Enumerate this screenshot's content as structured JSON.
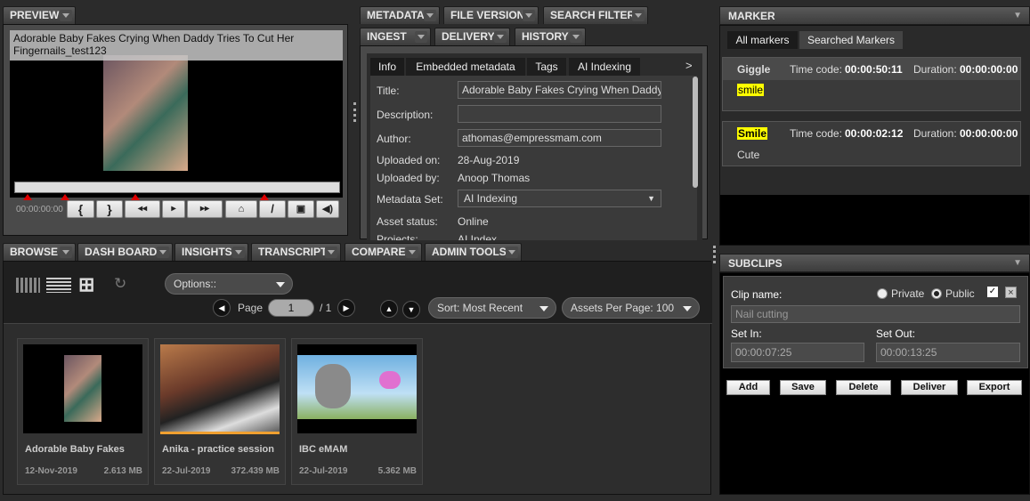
{
  "preview": {
    "tab": "PREVIEW",
    "title": "Adorable Baby Fakes Crying When Daddy Tries To Cut Her Fingernails_test123",
    "timecode": "00:00:00:00"
  },
  "meta_tabs": {
    "row1": [
      "METADATA",
      "FILE VERSION",
      "SEARCH FILTER"
    ],
    "row2": [
      "INGEST",
      "DELIVERY",
      "HISTORY"
    ],
    "sub": [
      "Info",
      "Embedded metadata",
      "Tags",
      "AI Indexing"
    ],
    "more": ">"
  },
  "info": {
    "title_label": "Title:",
    "title_value": "Adorable Baby Fakes Crying When Daddy",
    "description_label": "Description:",
    "description_value": "",
    "author_label": "Author:",
    "author_value": "athomas@empressmam.com",
    "uploaded_on_label": "Uploaded on:",
    "uploaded_on_value": "28-Aug-2019",
    "uploaded_by_label": "Uploaded by:",
    "uploaded_by_value": "Anoop Thomas",
    "metadata_set_label": "Metadata Set:",
    "metadata_set_value": "AI Indexing",
    "asset_status_label": "Asset status:",
    "asset_status_value": "Online",
    "projects_label": "Projects:",
    "projects_value": "AI Index"
  },
  "marker": {
    "header": "MARKER",
    "tabs": [
      "All markers",
      "Searched Markers"
    ],
    "timecode_label": "Time code:",
    "duration_label": "Duration:",
    "items": [
      {
        "name": "Giggle",
        "timecode": "00:00:50:11",
        "duration": "00:00:00:00",
        "note": "smile"
      },
      {
        "name": "Smile",
        "timecode": "00:00:02:12",
        "duration": "00:00:00:00",
        "note": "Cute"
      }
    ]
  },
  "browse_tabs": [
    "BROWSE",
    "DASH BOARD",
    "INSIGHTS",
    "TRANSCRIPT",
    "COMPARE",
    "ADMIN TOOLS"
  ],
  "toolbar": {
    "options": "Options::",
    "page_label": "Page",
    "page_value": "1",
    "page_total": "/ 1",
    "sort": "Sort: Most Recent",
    "per_page": "Assets Per Page: 100"
  },
  "assets": [
    {
      "name": "Adorable Baby Fakes",
      "date": "12-Nov-2019",
      "size": "2.613 MB"
    },
    {
      "name": "Anika - practice session",
      "date": "22-Jul-2019",
      "size": "372.439 MB"
    },
    {
      "name": "IBC eMAM",
      "date": "22-Jul-2019",
      "size": "5.362 MB"
    }
  ],
  "subclips": {
    "header": "SUBCLIPS",
    "clip_name_label": "Clip name:",
    "private_label": "Private",
    "public_label": "Public",
    "clip_name_placeholder": "Nail cutting",
    "set_in_label": "Set In:",
    "set_out_label": "Set Out:",
    "set_in_value": "00:00:07:25",
    "set_out_value": "00:00:13:25",
    "buttons": [
      "Add",
      "Save",
      "Delete",
      "Deliver",
      "Export"
    ]
  },
  "colors": {
    "highlight": "#ffff00",
    "bg": "#2b2b2b",
    "progress": "#f0a030"
  }
}
